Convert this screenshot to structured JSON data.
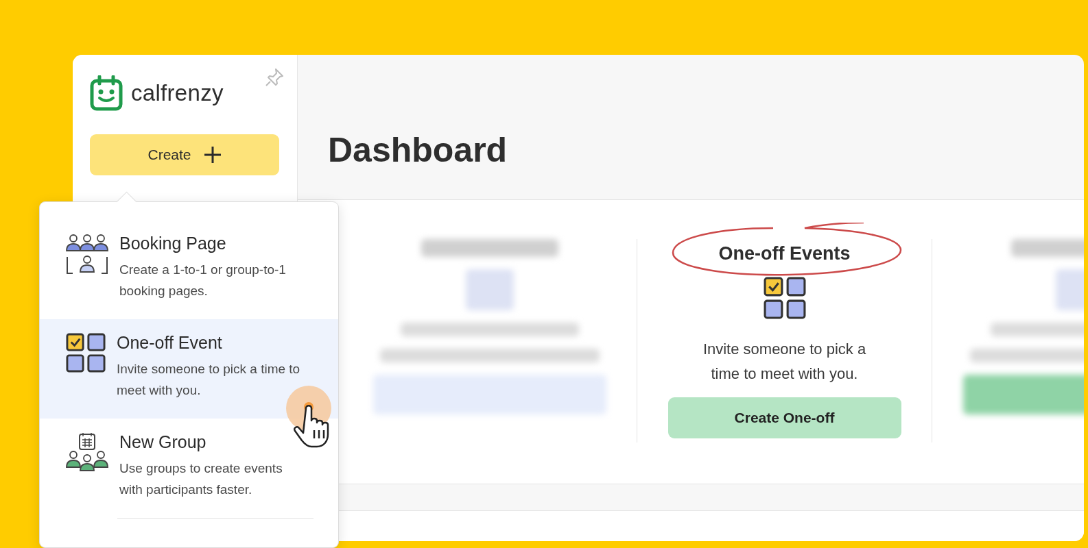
{
  "logo": {
    "name": "calfrenzy"
  },
  "create_button": {
    "label": "Create"
  },
  "page_title": "Dashboard",
  "create_menu": {
    "items": [
      {
        "kind": "booking",
        "title": "Booking Page",
        "description": "Create a 1-to-1 or group-to-1 booking pages.",
        "selected": false
      },
      {
        "kind": "one_off",
        "title": "One-off Event",
        "description": "Invite someone to pick a time to meet with you.",
        "selected": true
      },
      {
        "kind": "group",
        "title": "New Group",
        "description": "Use groups to create events with participants faster.",
        "selected": false
      }
    ]
  },
  "cards": [
    {
      "kind": "blurred"
    },
    {
      "kind": "featured",
      "title": "One-off Events",
      "circled": true,
      "description": "Invite someone to pick a time to meet with you.",
      "button": "Create One-off"
    },
    {
      "kind": "blurred"
    }
  ]
}
